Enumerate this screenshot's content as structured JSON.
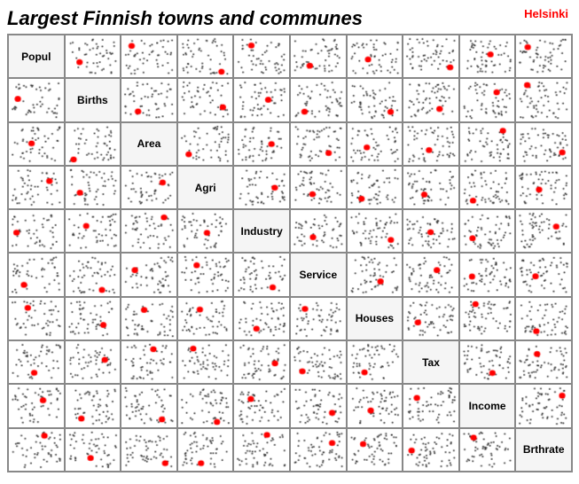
{
  "title": "Largest Finnish towns and communes",
  "helsinki_label": "Helsinki",
  "labels": [
    "Popul",
    "Births",
    "Area",
    "Agri",
    "Industry",
    "Service",
    "Houses",
    "Tax",
    "Income",
    "Brthrate"
  ],
  "grid_size": 9,
  "accent_color": "#ff0000"
}
